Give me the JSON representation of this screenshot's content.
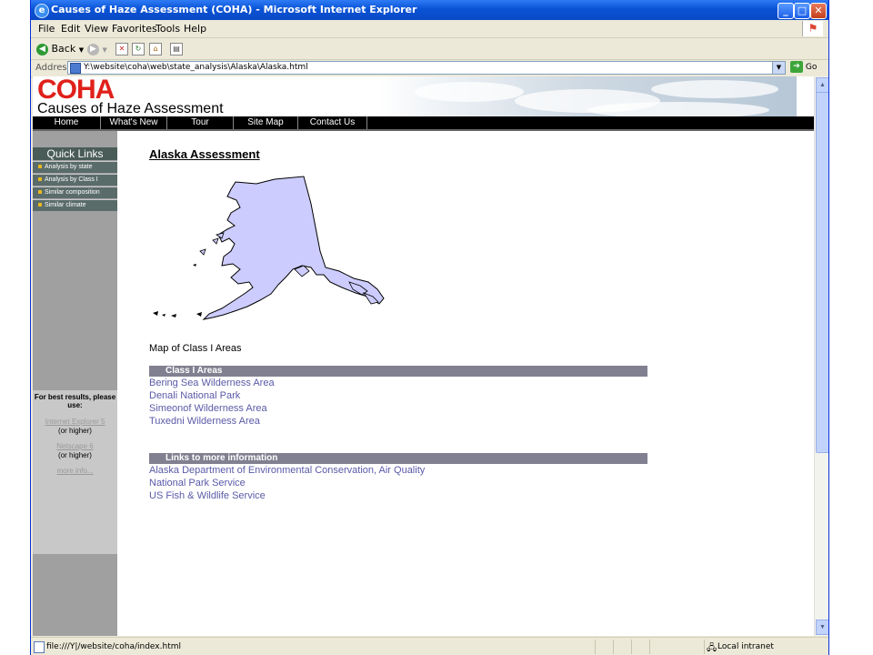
{
  "window": {
    "title": "Causes of Haze Assessment (COHA) - Microsoft Internet Explorer",
    "buttons": {
      "minimize": "_",
      "maximize": "□",
      "close": "✕"
    }
  },
  "menu": [
    "File",
    "Edit",
    "View",
    "Favorites",
    "Tools",
    "Help"
  ],
  "toolbar": {
    "back": "Back"
  },
  "address": {
    "label": "Address",
    "url": "Y:\\website\\coha\\web\\state_analysis\\Alaska\\Alaska.html",
    "go": "Go"
  },
  "site": {
    "logo": "COHA",
    "subtitle": "Causes of Haze Assessment",
    "nav": [
      "Home",
      "What's New",
      "Tour",
      "Site Map",
      "Contact Us"
    ]
  },
  "quick_links": {
    "heading": "Quick Links",
    "items": [
      "Analysis by state",
      "Analysis by Class I",
      "Similar composition",
      "Similar climate"
    ]
  },
  "best_results": {
    "heading": "For best results, please use:",
    "browser1": "Internet Explorer 5",
    "browser1_note": "(or higher)",
    "browser2": "Netscape 6",
    "browser2_note": "(or higher)",
    "more": "more info..."
  },
  "main": {
    "title": "Alaska Assessment",
    "map_caption": "Map of Class I Areas",
    "class_areas_heading": "Class I Areas",
    "class_areas": [
      "Bering Sea Wilderness Area",
      "Denali National Park",
      "Simeonof Wilderness Area",
      "Tuxedni Wilderness Area"
    ],
    "links_heading": "Links to more information",
    "links": [
      "Alaska Department of Environmental Conservation, Air Quality",
      "National Park Service",
      "US Fish & Wildlife Service"
    ]
  },
  "status": {
    "text": "file:///Y|/website/coha/index.html",
    "zone": "Local intranet"
  },
  "colors": {
    "title_bar": "#0a53d6",
    "logo": "#e0201a",
    "nav": "#000000",
    "link": "#5a5aa8",
    "map_fill": "#ccccff",
    "section_bar": "#808090"
  }
}
